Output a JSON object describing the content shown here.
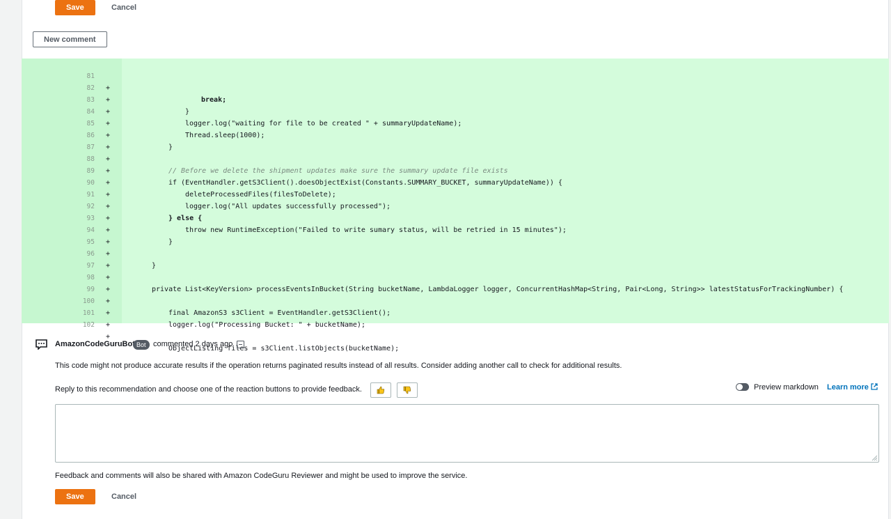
{
  "top_actions": {
    "save_label": "Save",
    "cancel_label": "Cancel"
  },
  "new_comment_label": "New comment",
  "diff": {
    "marker": "+",
    "lines": [
      {
        "num": "81",
        "code": "break;"
      },
      {
        "num": "82",
        "code": "}"
      },
      {
        "num": "83",
        "code": "logger.log(\"waiting for file to be created \" + summaryUpdateName);"
      },
      {
        "num": "84",
        "code": "Thread.sleep(1000);"
      },
      {
        "num": "85",
        "code": "}"
      },
      {
        "num": "86",
        "code": ""
      },
      {
        "num": "87",
        "code": "// Before we delete the shipment updates make sure the summary update file exists"
      },
      {
        "num": "88",
        "code": "if (EventHandler.getS3Client().doesObjectExist(Constants.SUMMARY_BUCKET, summaryUpdateName)) {"
      },
      {
        "num": "89",
        "code": "deleteProcessedFiles(filesToDelete);"
      },
      {
        "num": "90",
        "code": "logger.log(\"All updates successfully processed\");"
      },
      {
        "num": "91",
        "code": "} else {"
      },
      {
        "num": "92",
        "code": "throw new RuntimeException(\"Failed to write sumary status, will be retried in 15 minutes\");"
      },
      {
        "num": "93",
        "code": "}"
      },
      {
        "num": "94",
        "code": ""
      },
      {
        "num": "95",
        "code": "}"
      },
      {
        "num": "96",
        "code": ""
      },
      {
        "num": "97",
        "code": "private List<KeyVersion> processEventsInBucket(String bucketName, LambdaLogger logger, ConcurrentHashMap<String, Pair<Long, String>> latestStatusForTrackingNumber) {"
      },
      {
        "num": "98",
        "code": ""
      },
      {
        "num": "99",
        "code": "final AmazonS3 s3Client = EventHandler.getS3Client();"
      },
      {
        "num": "100",
        "code": "logger.log(\"Processing Bucket: \" + bucketName);"
      },
      {
        "num": "101",
        "code": ""
      },
      {
        "num": "102",
        "code": "ObjectListing files = s3Client.listObjects(bucketName);"
      }
    ]
  },
  "comment": {
    "author": "AmazonCodeGuruBot",
    "badge": "Bot",
    "meta": "commented 2 days ago",
    "message": "This code might not produce accurate results if the operation returns paginated results instead of all results. Consider adding another call to check for additional results.",
    "reply_prompt": "Reply to this recommendation and choose one of the reaction buttons to provide feedback.",
    "preview_label": "Preview markdown",
    "learn_more": "Learn more",
    "textarea_value": "",
    "note": "Feedback and comments will also be shared with Amazon CodeGuru Reviewer and might be used to improve the service."
  },
  "bottom_actions": {
    "save_label": "Save",
    "cancel_label": "Cancel"
  },
  "colors": {
    "accent": "#ec7211",
    "diff_bg": "#d4fcdc",
    "link": "#0073bb"
  }
}
